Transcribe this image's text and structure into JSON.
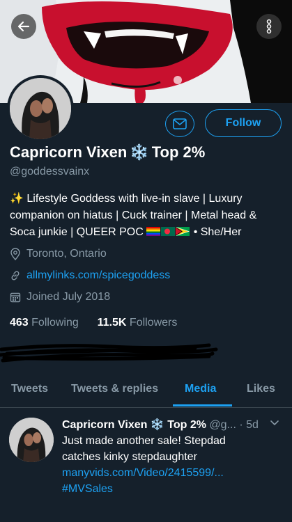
{
  "header": {
    "back_icon": "arrow-left-icon",
    "more_icon": "vertical-dots-icon"
  },
  "profile": {
    "name": "Capricorn Vixen",
    "name_emoji": "❄️",
    "name_suffix": "Top 2%",
    "handle": "@goddessvainx",
    "follow_label": "Follow",
    "bio_sparkle": "✨",
    "bio_line1": "Lifestyle Goddess with live-in slave | Luxury",
    "bio_line2": "companion on hiatus | Cuck trainer | Metal head &",
    "bio_line3_prefix": "Soca junkie | QUEER POC",
    "bio_line3_suffix": "• She/Her",
    "location": "Toronto, Ontario",
    "website": "allmylinks.com/spicegoddess",
    "joined": "Joined July 2018",
    "following_count": "463",
    "following_label": "Following",
    "followers_count": "11.5K",
    "followers_label": "Followers"
  },
  "tabs": [
    {
      "label": "Tweets"
    },
    {
      "label": "Tweets & replies"
    },
    {
      "label": "Media"
    },
    {
      "label": "Likes"
    }
  ],
  "active_tab": "Media",
  "tweet": {
    "name": "Capricorn Vixen",
    "name_emoji": "❄️",
    "name_suffix": "Top 2%",
    "handle": "@g...",
    "time": "· 5d",
    "line1": "Just made another sale! Stepdad",
    "line2": "catches kinky stepdaughter",
    "link": "manyvids.com/Video/2415599/...",
    "hashtag": "#MVSales"
  },
  "colors": {
    "background": "#15202b",
    "accent": "#1da1f2",
    "muted": "#8899a6",
    "banner_lips": "#d0102a"
  }
}
